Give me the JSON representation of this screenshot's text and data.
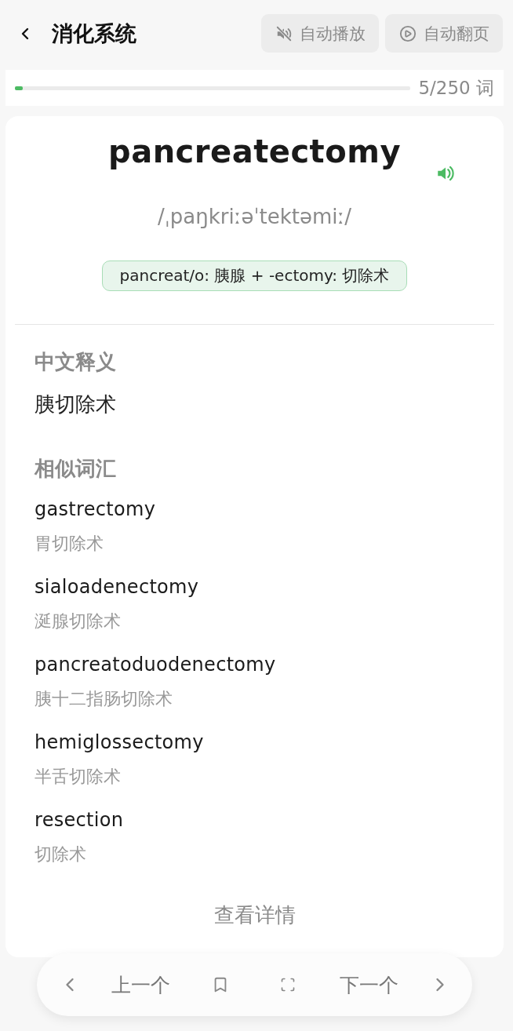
{
  "header": {
    "title": "消化系统",
    "buttons": [
      {
        "kind": "sound",
        "label": "自动播放",
        "on": false
      },
      {
        "kind": "page",
        "label": "自动翻页",
        "on": false
      }
    ]
  },
  "progress": {
    "level": 0.02,
    "reading": "5/250 词"
  },
  "word": {
    "term": "pancreatectomy",
    "phonetic": "/ˌpaŋkriːəˈtektəmiː/",
    "etymology": "pancreat/o: 胰腺 + -ectomy: 切除术"
  },
  "meaning": {
    "heading": "中文释义",
    "text": "胰切除术"
  },
  "similar": {
    "heading": "相似词汇",
    "items": [
      {
        "term": "gastrectomy",
        "meaning": "胃切除术"
      },
      {
        "term": "sialoadenectomy",
        "meaning": "涎腺切除术"
      },
      {
        "term": "pancreatoduodenectomy",
        "meaning": "胰十二指肠切除术"
      },
      {
        "term": "hemiglossectomy",
        "meaning": "半舌切除术"
      },
      {
        "term": "resection",
        "meaning": "切除术"
      }
    ]
  },
  "details_link": "查看详情",
  "bottom_nav": {
    "prev": "上一个",
    "next": "下一个",
    "bookmarked": false
  }
}
